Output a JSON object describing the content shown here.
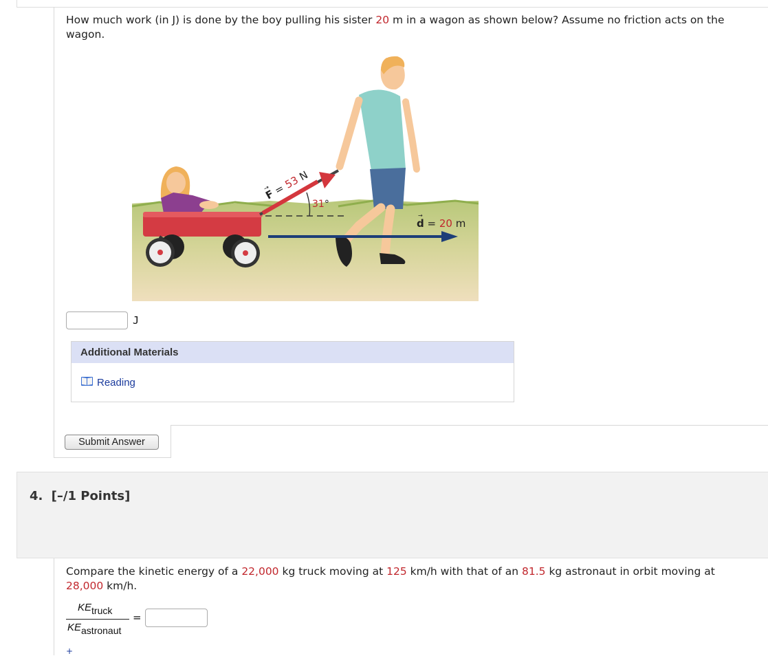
{
  "question3": {
    "text_before": "How much work (in J) is done by the boy pulling his sister ",
    "distance": "20",
    "text_after": " m in a wagon as shown below? Assume no friction acts on the wagon.",
    "figure": {
      "force_symbol": "F",
      "force_eq": " = ",
      "force_value": "53",
      "force_unit": " N",
      "angle_value": "31",
      "angle_unit": "°",
      "displacement_symbol": "d",
      "displacement_eq": " = ",
      "displacement_value": "20",
      "displacement_unit": " m"
    },
    "answer_value": "",
    "answer_unit": "J",
    "additional_materials": {
      "heading": "Additional Materials",
      "link_label": "Reading"
    },
    "submit_label": "Submit Answer"
  },
  "question4": {
    "number": "4.",
    "points": "[–/1 Points]",
    "text_1": "Compare the kinetic energy of a ",
    "truck_mass": "22,000",
    "text_2": " kg truck moving at ",
    "truck_speed": "125",
    "text_3": " km/h with that of an ",
    "astronaut_mass": "81.5",
    "text_4": " kg astronaut in orbit moving at ",
    "astronaut_speed": "28,000",
    "text_5": " km/h.",
    "numerator_ke": "KE",
    "numerator_sub": "truck",
    "denominator_ke": "KE",
    "denominator_sub": "astronaut",
    "equals": "=",
    "answer_value": "",
    "more_symbol": "+"
  },
  "colors": {
    "given_value": "#c1272d",
    "link": "#1a3a9c",
    "materials_header_bg": "#dbe0f5",
    "question_header_bg": "#f2f2f2"
  },
  "icons": [
    "book-icon"
  ]
}
